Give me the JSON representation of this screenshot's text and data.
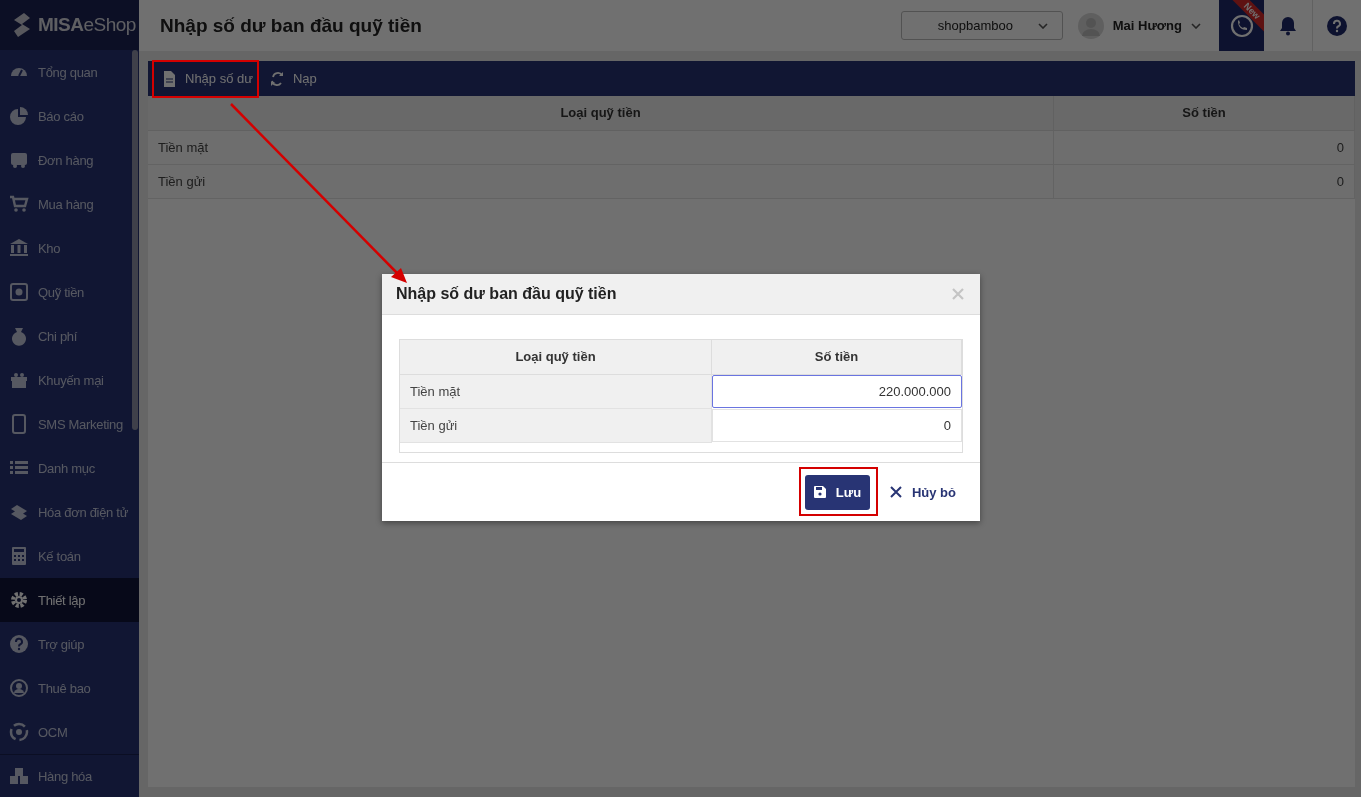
{
  "logo": {
    "text": "**MISA**eShop"
  },
  "sidebar": {
    "items": [
      {
        "label": "Tổng quan",
        "selected": false
      },
      {
        "label": "Báo cáo",
        "selected": false
      },
      {
        "label": "Đơn hàng",
        "selected": false
      },
      {
        "label": "Mua hàng",
        "selected": false
      },
      {
        "label": "Kho",
        "selected": false
      },
      {
        "label": "Quỹ tiền",
        "selected": false
      },
      {
        "label": "Chi phí",
        "selected": false
      },
      {
        "label": "Khuyến mại",
        "selected": false
      },
      {
        "label": "SMS Marketing",
        "selected": false
      },
      {
        "label": "Danh mục",
        "selected": false
      },
      {
        "label": "Hóa đơn điện tử",
        "selected": false
      },
      {
        "label": "Kế toán",
        "selected": false
      },
      {
        "label": "Thiết lập",
        "selected": true
      },
      {
        "label": "Trợ giúp",
        "selected": false
      },
      {
        "label": "Thuê bao",
        "selected": false
      },
      {
        "label": "OCM",
        "selected": false
      }
    ],
    "footer_item": {
      "label": "Hàng hóa"
    }
  },
  "header": {
    "title": "Nhập số dư ban đầu quỹ tiền",
    "shop_select": {
      "value": "shopbamboo"
    },
    "user": {
      "name": "Mai Hương"
    },
    "badge": "New"
  },
  "toolbar": {
    "buttons": [
      "Nhập số dư",
      "Nạp"
    ]
  },
  "table": {
    "columns": [
      "Loại quỹ tiền",
      "Số tiền"
    ],
    "rows": [
      {
        "type": "Tiền mặt",
        "amount": "0"
      },
      {
        "type": "Tiền gửi",
        "amount": "0"
      }
    ]
  },
  "modal": {
    "title": "Nhập số dư ban đầu quỹ tiền",
    "table": {
      "columns": [
        "Loại quỹ tiền",
        "Số tiền"
      ],
      "rows": [
        {
          "type": "Tiền mặt",
          "amount": "220.000.000",
          "focused": true
        },
        {
          "type": "Tiền gửi",
          "amount": "0",
          "focused": false
        }
      ]
    },
    "buttons": {
      "save": "Lưu",
      "cancel": "Hủy bỏ"
    }
  }
}
